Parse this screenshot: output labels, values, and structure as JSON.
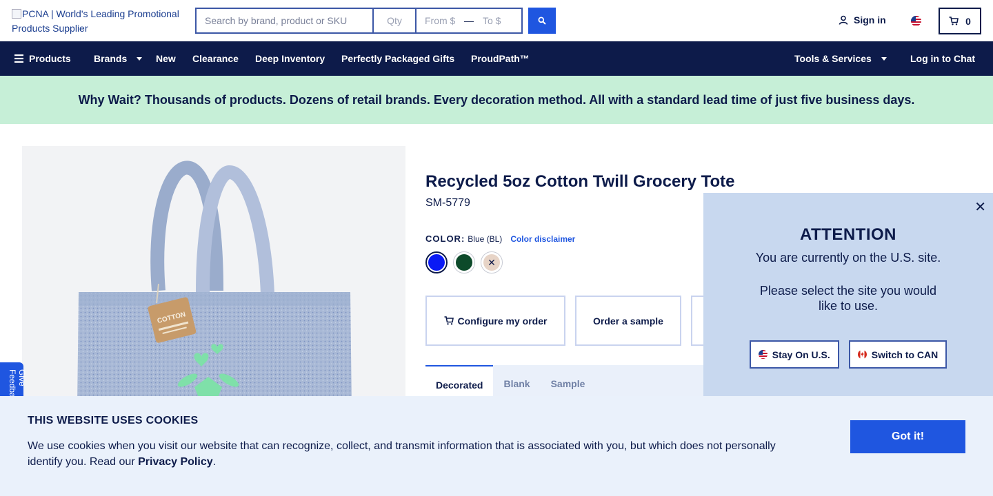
{
  "header": {
    "logo_alt": "PCNA | World's Leading Promotional Products Supplier",
    "search": {
      "main_placeholder": "Search by brand, product or SKU",
      "qty_placeholder": "Qty",
      "from_placeholder": "From $",
      "dash": "—",
      "to_placeholder": "To $"
    },
    "sign_in": "Sign in",
    "cart_count": "0"
  },
  "nav": {
    "items": [
      "Products",
      "Brands",
      "New",
      "Clearance",
      "Deep Inventory",
      "Perfectly Packaged Gifts",
      "ProudPath™"
    ],
    "tools": "Tools & Services",
    "chat": "Log in to Chat"
  },
  "banner": {
    "text": "Why Wait? Thousands of products. Dozens of retail brands. Every decoration method. All with a standard lead time of just five business days."
  },
  "product": {
    "title": "Recycled 5oz Cotton Twill Grocery Tote",
    "sku": "SM-5779",
    "color_label": "COLOR:",
    "color_value": "Blue (BL)",
    "color_disclaimer": "Color disclaimer",
    "swatches": [
      {
        "name": "Blue",
        "color": "#0a1af5"
      },
      {
        "name": "Green",
        "color": "#0d4a2a"
      },
      {
        "name": "Natural",
        "color": "#e7d4c7"
      }
    ],
    "tag_text": "COTTON",
    "actions": [
      "Configure my order",
      "Order a sample"
    ],
    "tabs": [
      "Decorated",
      "Blank",
      "Sample"
    ]
  },
  "feedback": {
    "label": "Give Feedback"
  },
  "region_modal": {
    "heading": "ATTENTION",
    "line1": "You are currently on the U.S. site.",
    "line2": "Please select the site you would like to use.",
    "stay": "Stay On U.S.",
    "switch": "Switch to CAN"
  },
  "cookie": {
    "heading": "THIS WEBSITE USES COOKIES",
    "body": "We use cookies when you visit our website that can recognize, collect, and transmit information that is associated with you, but which does not personally identify you. Read our ",
    "link": "Privacy Policy",
    "period": ".",
    "button": "Got it!"
  },
  "colors": {
    "navy": "#0d1b4a",
    "accent_blue": "#1f56e0",
    "banner_green": "#c6efd7",
    "modal_bg": "#c8d8ef",
    "cookie_bg": "#eaf1fb"
  }
}
